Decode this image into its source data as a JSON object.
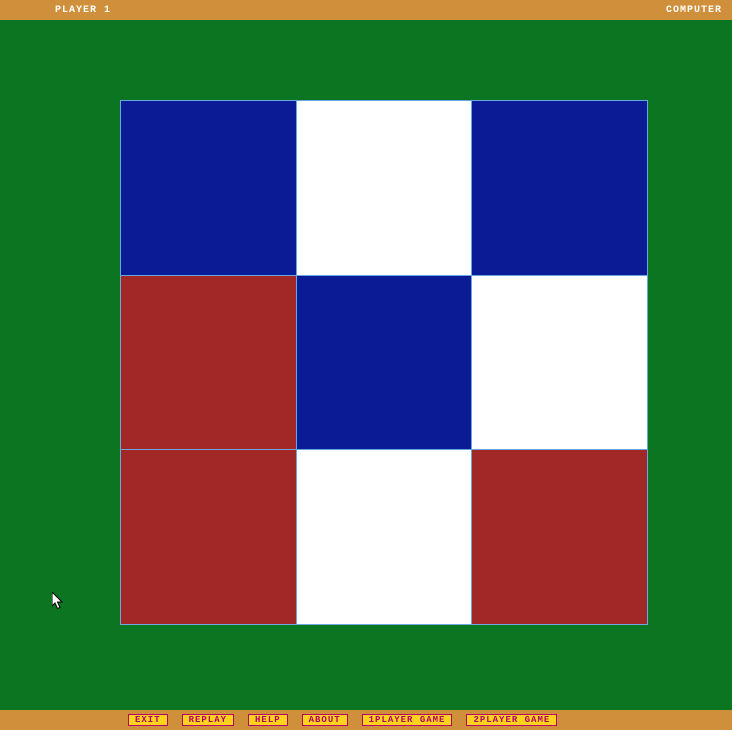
{
  "header": {
    "left_label": "PLAYER 1",
    "right_label": "COMPUTER"
  },
  "board": {
    "colors": {
      "blue": "#0b1b95",
      "white": "#ffffff",
      "red": "#a22828",
      "grid_line": "#6aa6e0",
      "playfield": "#0c7521",
      "frame": "#d08f3a"
    },
    "cells": [
      [
        "blue",
        "white",
        "blue"
      ],
      [
        "red",
        "blue",
        "white"
      ],
      [
        "red",
        "white",
        "red"
      ]
    ]
  },
  "buttons": {
    "exit": "EXIT",
    "replay": "REPLAY",
    "help": "HELP",
    "about": "ABOUT",
    "one_player": "1PLAYER GAME",
    "two_player": "2PLAYER GAME"
  }
}
